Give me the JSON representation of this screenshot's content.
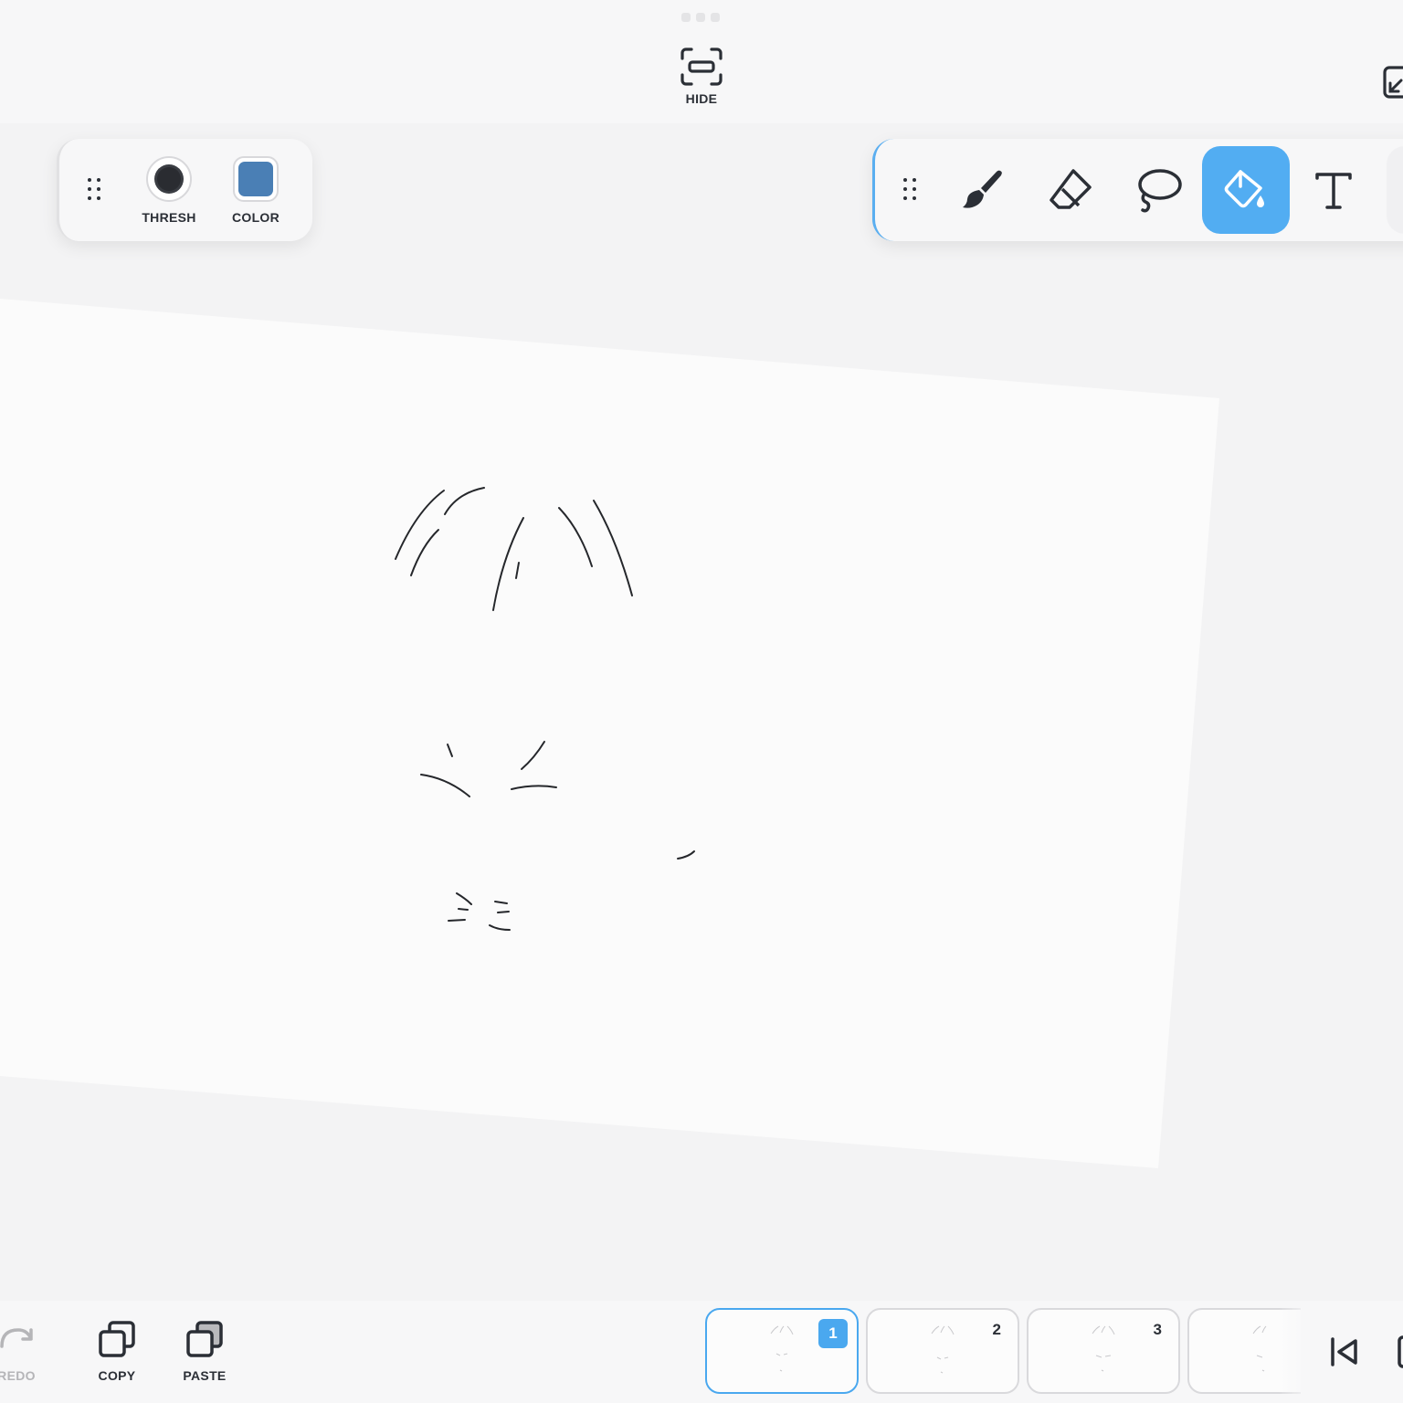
{
  "topbar": {
    "hide_label": "HIDE"
  },
  "brush_options": {
    "thresh_label": "THRESH",
    "color_label": "COLOR",
    "color_value": "#4a7fb5"
  },
  "tools": [
    {
      "name": "brush-icon",
      "active": false
    },
    {
      "name": "eraser-icon",
      "active": false
    },
    {
      "name": "lasso-icon",
      "active": false
    },
    {
      "name": "fill-bucket-icon",
      "active": true
    },
    {
      "name": "text-icon",
      "active": false
    }
  ],
  "colors": {
    "accent": "#52adf2",
    "ink": "#2b2f36",
    "paper": "#fbfbfb"
  },
  "bottombar": {
    "redo_label": "REDO",
    "copy_label": "COPY",
    "paste_label": "PASTE"
  },
  "frames": [
    {
      "number": "1",
      "active": true
    },
    {
      "number": "2",
      "active": false
    },
    {
      "number": "3",
      "active": false
    },
    {
      "number": "",
      "active": false
    }
  ]
}
